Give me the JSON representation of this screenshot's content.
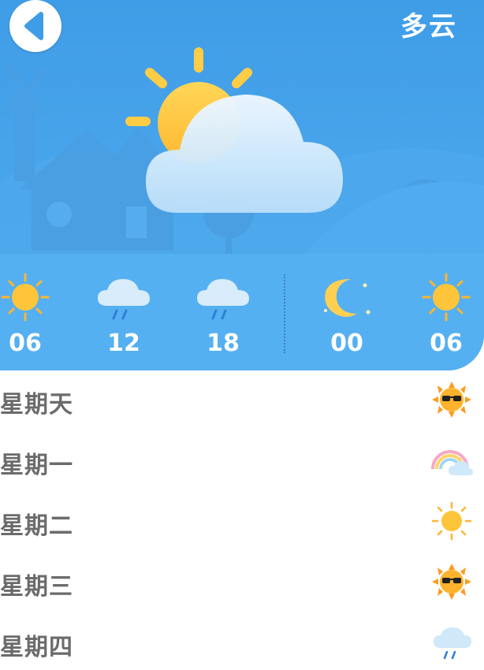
{
  "header": {
    "condition": "多云",
    "back_icon": "chevron-left-icon",
    "main_icon": "sun-behind-cloud-icon"
  },
  "hourly": [
    {
      "label": "06",
      "icon": "sun-icon"
    },
    {
      "label": "12",
      "icon": "cloud-rain-icon"
    },
    {
      "label": "18",
      "icon": "cloud-rain-icon"
    },
    {
      "label": "00",
      "icon": "moon-stars-icon"
    },
    {
      "label": "06",
      "icon": "sun-icon"
    }
  ],
  "daily": [
    {
      "day": "星期天",
      "icon": "sun-sunglasses-icon"
    },
    {
      "day": "星期一",
      "icon": "rainbow-cloud-icon"
    },
    {
      "day": "星期二",
      "icon": "sun-icon"
    },
    {
      "day": "星期三",
      "icon": "sun-sunglasses-icon"
    },
    {
      "day": "星期四",
      "icon": "cloud-rain-icon"
    }
  ],
  "colors": {
    "sky": "#3f9de7",
    "sun": "#ffc53a",
    "cloud": "#d8ecfb",
    "day_text": "#6b6b6b"
  }
}
